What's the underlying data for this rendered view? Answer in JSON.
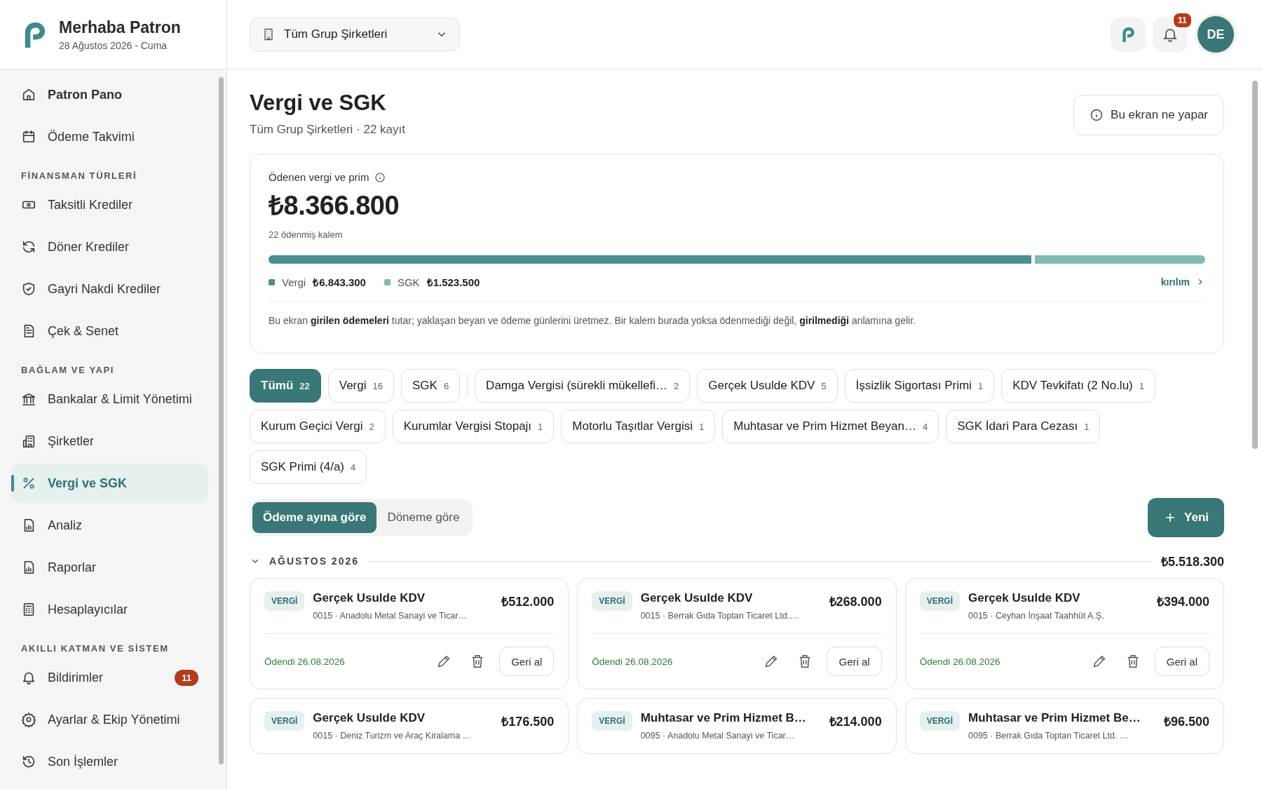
{
  "brand": {
    "title": "Merhaba Patron",
    "date": "28 Ağustos 2026 - Cuma"
  },
  "company_select": {
    "value": "Tüm Grup Şirketleri"
  },
  "topbar": {
    "notification_count": "11",
    "avatar": "DE"
  },
  "sidebar": {
    "sections": [
      {
        "items": [
          {
            "label": "Patron Pano",
            "selected": false,
            "bold": true
          },
          {
            "label": "Ödeme Takvimi",
            "selected": false,
            "bold": false
          }
        ]
      },
      {
        "title": "FİNANSMAN TÜRLERİ",
        "items": [
          {
            "label": "Taksitli Krediler",
            "selected": false,
            "bold": false
          },
          {
            "label": "Döner Krediler",
            "selected": false,
            "bold": false
          },
          {
            "label": "Gayri Nakdi Krediler",
            "selected": false,
            "bold": false
          },
          {
            "label": "Çek & Senet",
            "selected": false,
            "bold": false
          }
        ]
      },
      {
        "title": "BAĞLAM VE YAPI",
        "items": [
          {
            "label": "Bankalar & Limit Yönetimi",
            "selected": false,
            "bold": false
          },
          {
            "label": "Şirketler",
            "selected": false,
            "bold": false
          },
          {
            "label": "Vergi ve SGK",
            "selected": true,
            "bold": true
          },
          {
            "label": "Analiz",
            "selected": false,
            "bold": false
          },
          {
            "label": "Raporlar",
            "selected": false,
            "bold": false
          },
          {
            "label": "Hesaplayıcılar",
            "selected": false,
            "bold": false
          }
        ]
      },
      {
        "title": "AKILLI KATMAN VE SİSTEM",
        "items": [
          {
            "label": "Bildirimler",
            "selected": false,
            "bold": false,
            "badge": "11"
          },
          {
            "label": "Ayarlar & Ekip Yönetimi",
            "selected": false,
            "bold": false
          },
          {
            "label": "Son İşlemler",
            "selected": false,
            "bold": false
          }
        ]
      }
    ]
  },
  "page": {
    "title": "Vergi ve SGK",
    "subtitle": "Tüm Grup Şirketleri · 22 kayıt",
    "help_button": "Bu ekran ne yapar"
  },
  "summary": {
    "label": "Ödenen vergi ve prim",
    "total": "₺8.366.800",
    "count": "22 ödenmiş kalem",
    "segments": [
      {
        "name": "Vergi",
        "amount": "₺6.843.300",
        "level": 0.818,
        "color": "#4a8f8f"
      },
      {
        "name": "SGK",
        "amount": "₺1.523.500",
        "color": "#85b9b3"
      }
    ],
    "link": "kırılım",
    "note": "Bu ekran **girilen ödemeleri** tutar; yaklaşan beyan ve ödeme günlerini üretmez. Bir kalem burada yoksa ödenmediği değil, **girilmediği** anlamına gelir."
  },
  "filters": [
    {
      "label": "Tümü",
      "count": "22",
      "selected": true,
      "kind": "group"
    },
    {
      "label": "Vergi",
      "count": "16",
      "selected": false,
      "kind": "group"
    },
    {
      "label": "SGK",
      "count": "6",
      "selected": false,
      "kind": "group"
    },
    {
      "label": "Damga Vergisi (sürekli mükellefi…",
      "count": "2",
      "selected": false,
      "kind": "type"
    },
    {
      "label": "Gerçek Usulde KDV",
      "count": "5",
      "selected": false,
      "kind": "type"
    },
    {
      "label": "İşsizlik Sigortası Primi",
      "count": "1",
      "selected": false,
      "kind": "type"
    },
    {
      "label": "KDV Tevkifatı (2 No.lu)",
      "count": "1",
      "selected": false,
      "kind": "type"
    },
    {
      "label": "Kurum Geçici Vergi",
      "count": "2",
      "selected": false,
      "kind": "type"
    },
    {
      "label": "Kurumlar Vergisi Stopajı",
      "count": "1",
      "selected": false,
      "kind": "type"
    },
    {
      "label": "Motorlu Taşıtlar Vergisi",
      "count": "1",
      "selected": false,
      "kind": "type"
    },
    {
      "label": "Muhtasar ve Prim Hizmet Beyan…",
      "count": "4",
      "selected": false,
      "kind": "type"
    },
    {
      "label": "SGK İdari Para Cezası",
      "count": "1",
      "selected": false,
      "kind": "type"
    },
    {
      "label": "SGK Primi (4/a)",
      "count": "4",
      "selected": false,
      "kind": "type"
    }
  ],
  "view_toggle": [
    {
      "label": "Ödeme ayına göre",
      "selected": true
    },
    {
      "label": "Döneme göre",
      "selected": false
    }
  ],
  "new_button": "Yeni",
  "group": {
    "title": "AĞUSTOS 2026",
    "total": "₺5.518.300",
    "expanded": true,
    "cards": [
      {
        "tag": "VERGİ",
        "title": "Gerçek Usulde KDV",
        "company": "0015 · Anadolu Metal Sanayi ve Ticar…",
        "amount": "₺512.000",
        "status": "Ödendi 26.08.2026",
        "button": "Geri al"
      },
      {
        "tag": "VERGİ",
        "title": "Gerçek Usulde KDV",
        "company": "0015 · Berrak Gıda Toptan Ticaret Ltd.…",
        "amount": "₺268.000",
        "status": "Ödendi 26.08.2026",
        "button": "Geri al"
      },
      {
        "tag": "VERGİ",
        "title": "Gerçek Usulde KDV",
        "company": "0015 · Ceyhan İnşaat Taahhüt A.Ş.",
        "amount": "₺394.000",
        "status": "Ödendi 26.08.2026",
        "button": "Geri al"
      },
      {
        "tag": "VERGİ",
        "title": "Gerçek Usulde KDV",
        "company": "0015 · Deniz Turizm ve Araç Kiralama …",
        "amount": "₺176.500"
      },
      {
        "tag": "VERGİ",
        "title": "Muhtasar ve Prim Hizmet B…",
        "company": "0095 · Anadolu Metal Sanayi ve Ticar…",
        "amount": "₺214.000"
      },
      {
        "tag": "VERGİ",
        "title": "Muhtasar ve Prim Hizmet Be…",
        "company": "0095 · Berrak Gıda Toptan Ticaret Ltd. …",
        "amount": "₺96.500"
      }
    ]
  }
}
